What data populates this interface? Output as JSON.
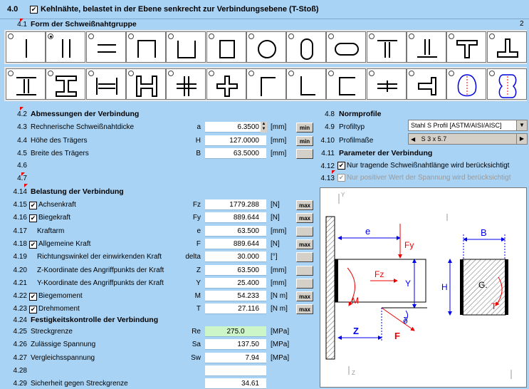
{
  "title": {
    "num": "4.0",
    "label": "Kehlnähte, belastet in der Ebene senkrecht zur Verbindungsebene (T-Stoß)",
    "check": "✔"
  },
  "shape_group": {
    "num": "4.1",
    "label": "Form der Schweißnahtgruppe",
    "count": "2"
  },
  "dims": {
    "num": "4.2",
    "label": "Abmessungen der Verbindung",
    "rows": [
      {
        "num": "4.3",
        "label": "Rechnerische Schweißnahtdicke",
        "sym": "a",
        "value": "6.3500",
        "unit": "[mm]",
        "btn": "min"
      },
      {
        "num": "4.4",
        "label": "Höhe des Trägers",
        "sym": "H",
        "value": "127.0000",
        "unit": "[mm]",
        "btn": "min"
      },
      {
        "num": "4.5",
        "label": "Breite des Trägers",
        "sym": "B",
        "value": "63.5000",
        "unit": "[mm]",
        "btn": ""
      }
    ],
    "empty": [
      "4.6",
      "4.7"
    ]
  },
  "load": {
    "num": "4.14",
    "label": "Belastung der Verbindung",
    "rows": [
      {
        "num": "4.15",
        "label": "Achsenkraft",
        "check": true,
        "sym": "Fz",
        "value": "1779.288",
        "unit": "[N]",
        "btn": "max"
      },
      {
        "num": "4.16",
        "label": "Biegekraft",
        "check": true,
        "sym": "Fy",
        "value": "889.644",
        "unit": "[N]",
        "btn": "max"
      },
      {
        "num": "4.17",
        "label": "Kraftarm",
        "check": false,
        "sym": "e",
        "value": "63.500",
        "unit": "[mm]",
        "btn": ""
      },
      {
        "num": "4.18",
        "label": "Allgemeine Kraft",
        "check": true,
        "sym": "F",
        "value": "889.644",
        "unit": "[N]",
        "btn": "max"
      },
      {
        "num": "4.19",
        "label": "Richtungswinkel der einwirkenden Kraft",
        "check": false,
        "sym": "delta",
        "value": "30.000",
        "unit": "[°]",
        "btn": ""
      },
      {
        "num": "4.20",
        "label": "Z-Koordinate des Angriffpunkts der Kraft",
        "check": false,
        "sym": "Z",
        "value": "63.500",
        "unit": "[mm]",
        "btn": ""
      },
      {
        "num": "4.21",
        "label": "Y-Koordinate des Angriffpunkts der Kraft",
        "check": false,
        "sym": "Y",
        "value": "25.400",
        "unit": "[mm]",
        "btn": ""
      },
      {
        "num": "4.22",
        "label": "Biegemoment",
        "check": true,
        "sym": "M",
        "value": "54.233",
        "unit": "[N m]",
        "btn": "max"
      },
      {
        "num": "4.23",
        "label": "Drehmoment",
        "check": true,
        "sym": "T",
        "value": "27.116",
        "unit": "[N m]",
        "btn": "max"
      }
    ]
  },
  "strength": {
    "num": "4.24",
    "label": "Festigkeitskontrolle der Verbindung",
    "rows": [
      {
        "num": "4.25",
        "label": "Streckgrenze",
        "sym": "Re",
        "value": "275.0",
        "unit": "[MPa]"
      },
      {
        "num": "4.26",
        "label": "Zulässige Spannung",
        "sym": "Sa",
        "value": "137.50",
        "unit": "[MPa]"
      },
      {
        "num": "4.27",
        "label": "Vergleichsspannung",
        "sym": "Sw",
        "value": "7.94",
        "unit": "[MPa]"
      },
      {
        "num": "4.28",
        "label": "",
        "sym": "",
        "value": "",
        "unit": ""
      },
      {
        "num": "4.29",
        "label": "Sicherheit gegen Streckgrenze",
        "sym": "",
        "value": "34.61",
        "unit": ""
      }
    ]
  },
  "profile": {
    "num": "4.8",
    "label": "Normprofile",
    "type_num": "4.9",
    "type_label": "Profiltyp",
    "type_value": "Stahl S Profil  [ASTM/AISI/AISC]",
    "size_num": "4.10",
    "size_label": "Profilmaße",
    "size_value": "S 3 x 5.7"
  },
  "params": {
    "num": "4.11",
    "label": "Parameter der Verbindung",
    "opt1_num": "4.12",
    "opt1": "Nur tragende Schweißnahtlänge wird berücksichtigt",
    "opt2_num": "4.13",
    "opt2": "Nur positiver Wert der Spannung wird berücksichtigt"
  },
  "diagram_labels": {
    "e": "e",
    "fy": "Fy",
    "fz": "Fz",
    "m": "M",
    "y": "Y",
    "z": "Z",
    "delta": "δ",
    "f": "F",
    "b": "B",
    "h": "H",
    "g": "G.",
    "t": "T"
  },
  "colors": {
    "bg": "#a9d3f5",
    "green": "#ccf5c8",
    "red": "#e00000",
    "blue": "#0000e0"
  }
}
